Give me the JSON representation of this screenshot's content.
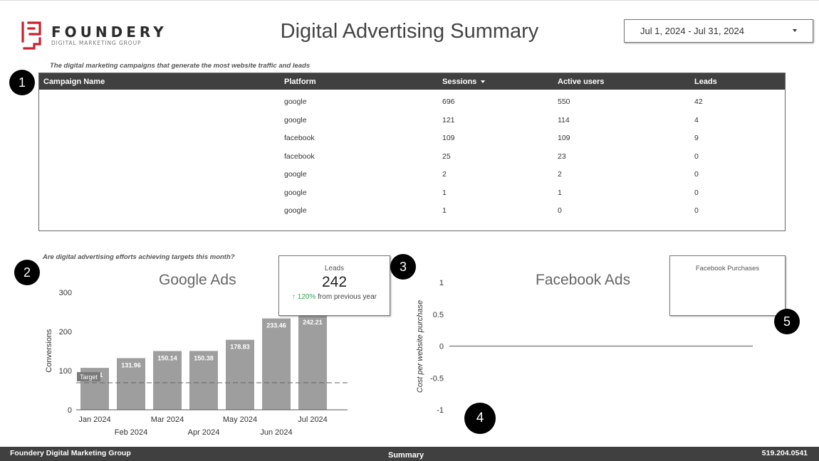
{
  "header": {
    "logo": {
      "name": "FOUNDERY",
      "tagline": "DIGITAL MARKETING GROUP",
      "brand_color": "#c8202f"
    },
    "title": "Digital Advertising Summary",
    "date_range": {
      "value": "Jul 1, 2024 - Jul 31, 2024",
      "icon": "caret-down-icon"
    }
  },
  "campaign_section": {
    "badge": "1",
    "caption": "The digital marketing campaigns that generate the most website traffic and leads",
    "table": {
      "columns": [
        "Campaign Name",
        "Platform",
        "Sessions",
        "Active users",
        "Leads"
      ],
      "sort_column": "Sessions",
      "sort_direction": "descending",
      "rows": [
        {
          "campaign": "",
          "platform": "google",
          "sessions": "696",
          "active_users": "550",
          "leads": "42"
        },
        {
          "campaign": "",
          "platform": "google",
          "sessions": "121",
          "active_users": "114",
          "leads": "4"
        },
        {
          "campaign": "",
          "platform": "facebook",
          "sessions": "109",
          "active_users": "109",
          "leads": "9"
        },
        {
          "campaign": "",
          "platform": "facebook",
          "sessions": "25",
          "active_users": "23",
          "leads": "0"
        },
        {
          "campaign": "",
          "platform": "google",
          "sessions": "2",
          "active_users": "2",
          "leads": "0"
        },
        {
          "campaign": "",
          "platform": "google",
          "sessions": "1",
          "active_users": "1",
          "leads": "0"
        },
        {
          "campaign": "",
          "platform": "google",
          "sessions": "1",
          "active_users": "0",
          "leads": "0"
        }
      ]
    }
  },
  "targets_section": {
    "badge": "2",
    "caption": "Are digital advertising efforts achieving targets this month?"
  },
  "leads_scorecard": {
    "badge": "3",
    "label": "Leads",
    "value": "242",
    "delta_arrow": "↑",
    "delta_value": "120%",
    "delta_text": "from previous year",
    "delta_color": "#34a853"
  },
  "facebook_scorecard": {
    "badge": "5",
    "label": "Facebook Purchases",
    "value": ""
  },
  "facebook_badge": "4",
  "chart_data": [
    {
      "type": "bar",
      "title": "Google Ads",
      "xlabel": "",
      "ylabel": "Conversions",
      "categories": [
        "Jan 2024",
        "Feb 2024",
        "Mar 2024",
        "Apr 2024",
        "May 2024",
        "Jun 2024",
        "Jul 2024"
      ],
      "values": [
        107.1,
        131.96,
        150.14,
        150.38,
        178.83,
        233.46,
        242.21
      ],
      "data_labels": [
        "107.1",
        "131.96",
        "150.14",
        "150.38",
        "178.83",
        "233.46",
        "242.21"
      ],
      "yticks": [
        0,
        100,
        200,
        300
      ],
      "ylim": [
        0,
        300
      ],
      "reference_line": {
        "label": "Target",
        "value": 69,
        "style": "dashed"
      },
      "bar_color": "#9e9e9e",
      "grid": false
    },
    {
      "type": "line",
      "title": "Facebook Ads",
      "xlabel": "",
      "ylabel": "Cost per website purchase",
      "series": [
        {
          "name": "Cost per website purchase",
          "values": [
            0,
            0
          ]
        }
      ],
      "yticks": [
        -1,
        -0.5,
        0,
        0.5,
        1
      ],
      "ytick_labels": [
        "-1",
        "-0.5",
        "0",
        "0.5",
        "1"
      ],
      "ylim": [
        -1,
        1
      ],
      "grid": false
    }
  ],
  "footer": {
    "left": "Foundery Digital Marketing Group",
    "center": "Summary",
    "right": "519.204.0541"
  }
}
